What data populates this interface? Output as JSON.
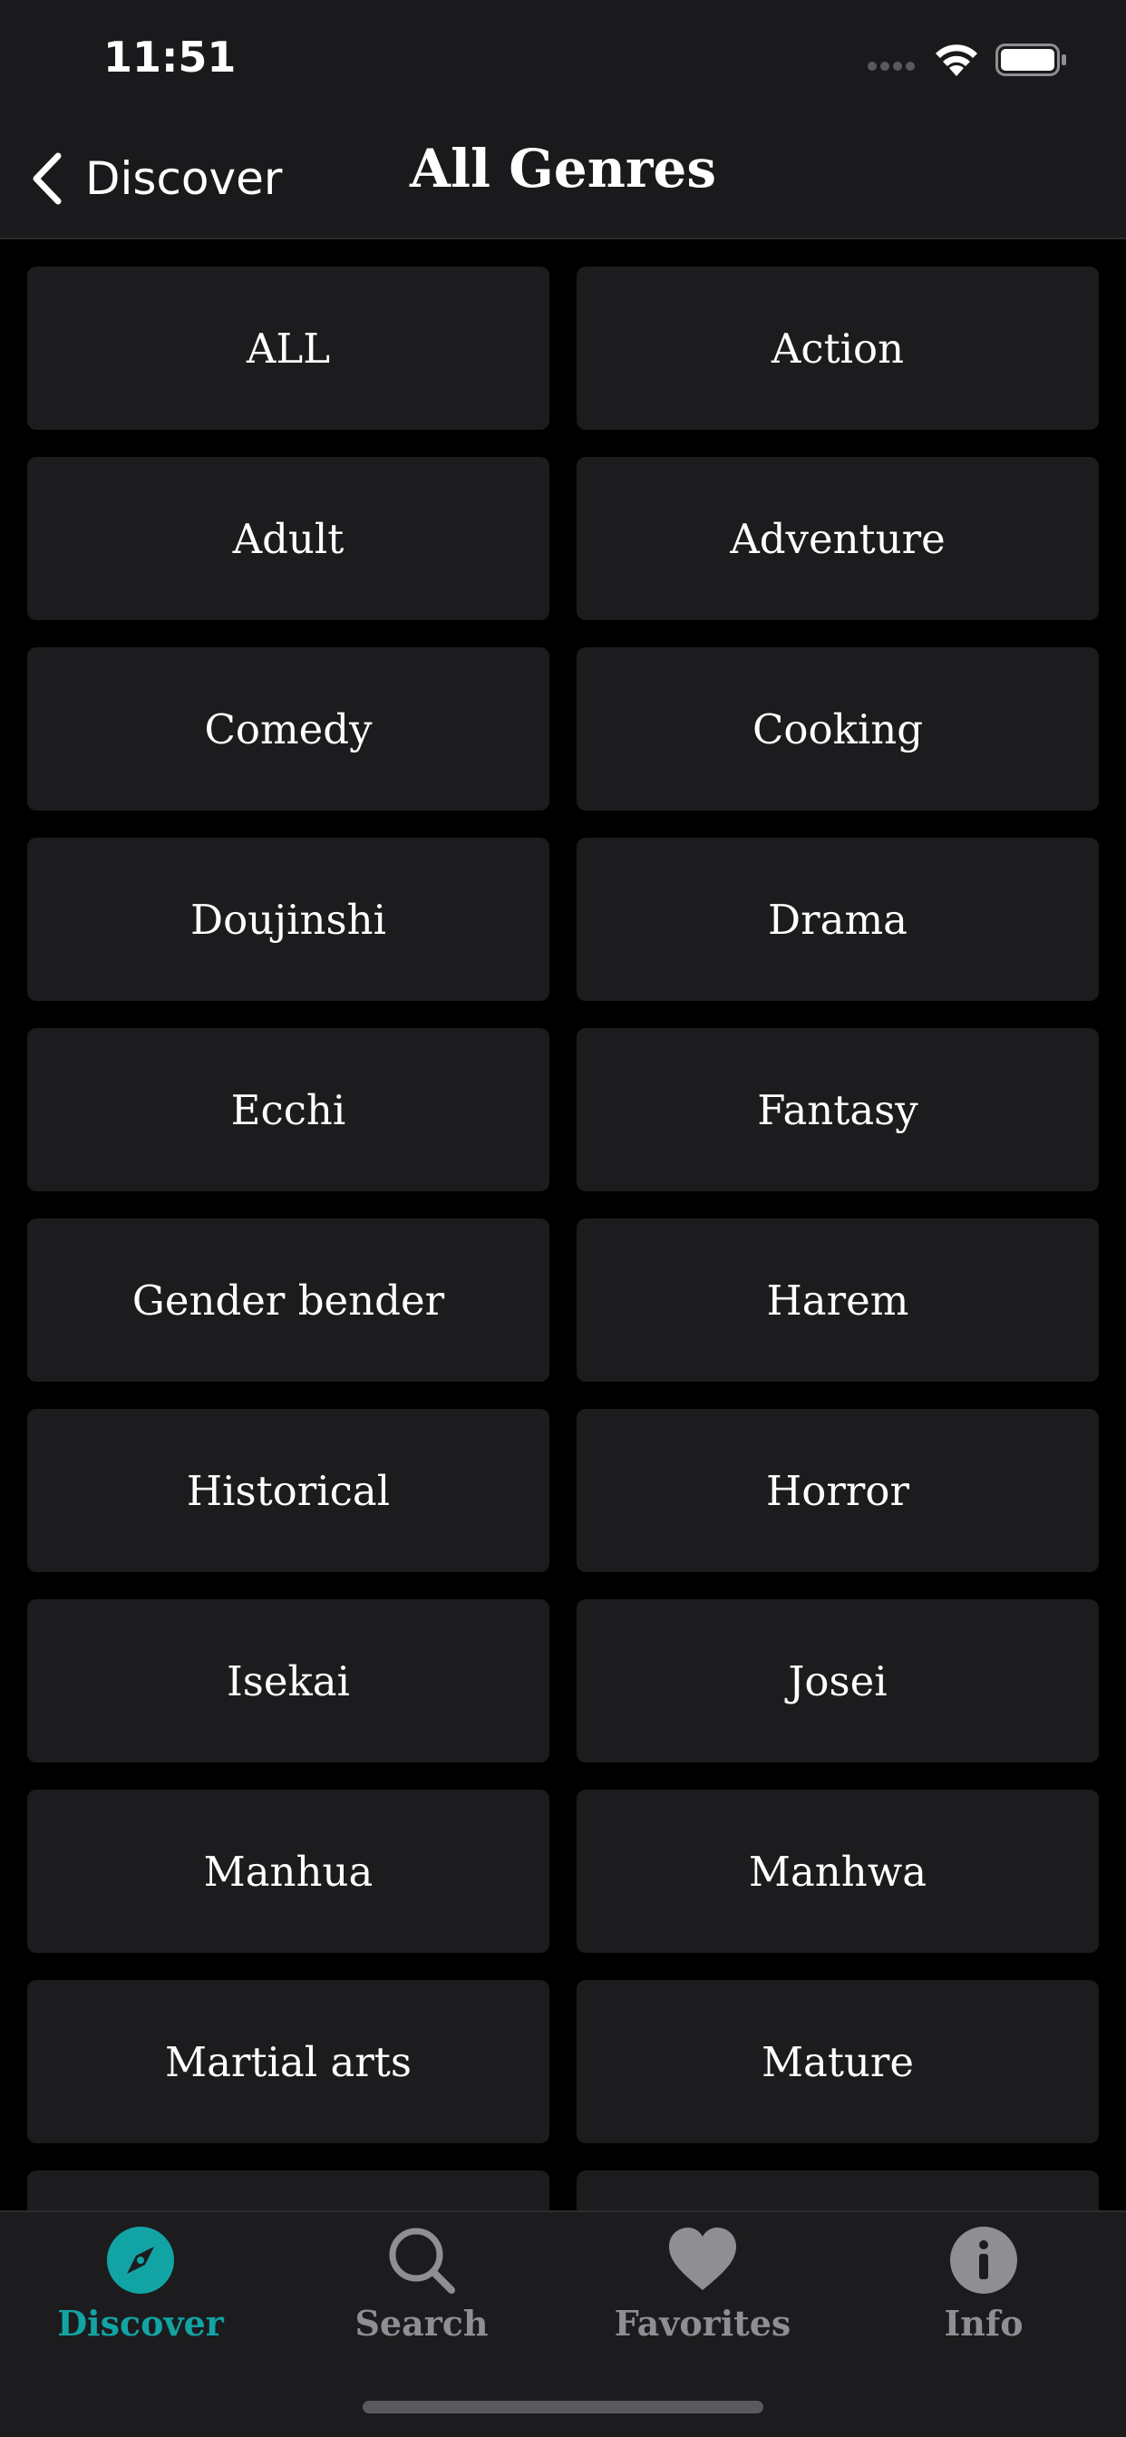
{
  "status_bar": {
    "time": "11:51"
  },
  "nav": {
    "back_label": "Discover",
    "title": "All Genres"
  },
  "genres": [
    "ALL",
    "Action",
    "Adult",
    "Adventure",
    "Comedy",
    "Cooking",
    "Doujinshi",
    "Drama",
    "Ecchi",
    "Fantasy",
    "Gender bender",
    "Harem",
    "Historical",
    "Horror",
    "Isekai",
    "Josei",
    "Manhua",
    "Manhwa",
    "Martial arts",
    "Mature"
  ],
  "tabs": [
    {
      "label": "Discover",
      "icon": "compass-icon",
      "active": true
    },
    {
      "label": "Search",
      "icon": "search-icon",
      "active": false
    },
    {
      "label": "Favorites",
      "icon": "heart-icon",
      "active": false
    },
    {
      "label": "Info",
      "icon": "info-icon",
      "active": false
    }
  ],
  "colors": {
    "accent": "#12a4a5",
    "tile": "#1c1c1e",
    "background": "#000000",
    "inactive": "#8e8e93"
  }
}
